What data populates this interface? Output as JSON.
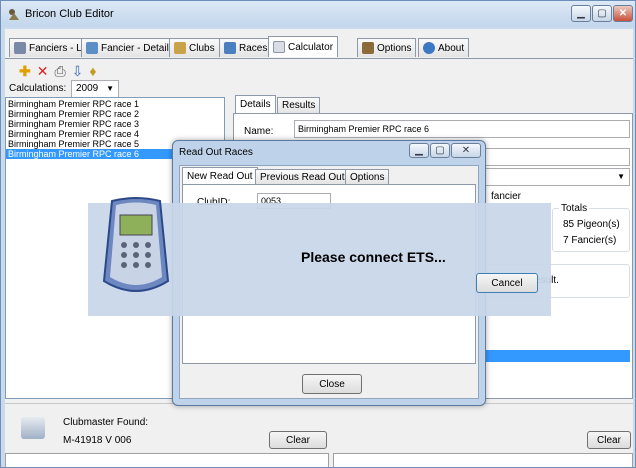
{
  "window": {
    "title": "Bricon Club Editor"
  },
  "tabs": [
    {
      "label": "Fanciers - List",
      "icon": "users-icon"
    },
    {
      "label": "Fancier - Detail",
      "icon": "user-icon"
    },
    {
      "label": "Clubs",
      "icon": "clubs-icon"
    },
    {
      "label": "Races",
      "icon": "flag-icon"
    },
    {
      "label": "Calculator",
      "icon": "calculator-icon"
    },
    {
      "label": "Options",
      "icon": "tools-icon"
    },
    {
      "label": "About",
      "icon": "info-icon"
    }
  ],
  "calc": {
    "label": "Calculations:",
    "year": "2009",
    "races": [
      "Birmingham Premier RPC race 1",
      "Birmingham Premier RPC race 2",
      "Birmingham Premier RPC race 3",
      "Birmingham Premier RPC race 4",
      "Birmingham Premier RPC race 5",
      "Birmingham Premier RPC race 6"
    ],
    "selected_index": 5
  },
  "details": {
    "tabs": [
      "Details",
      "Results"
    ],
    "name_label": "Name:",
    "name_value": "Birmingham Premier RPC race 6",
    "fancier_label": "fancier",
    "totals_label": "Totals",
    "pigeons": "85 Pigeon(s)",
    "fanciers": "7 Fancier(s)",
    "result_text": "esult."
  },
  "dialog": {
    "title": "Read Out Races",
    "tabs": [
      "New Read Out",
      "Previous Read Outs",
      "Options"
    ],
    "clubid_label": "ClubID:",
    "clubid_value": "0053",
    "close_label": "Close"
  },
  "overlay": {
    "message": "Please connect ETS...",
    "cancel_label": "Cancel"
  },
  "bottom": {
    "found_label": "Clubmaster Found:",
    "device": "M-41918 V 006",
    "clear_label": "Clear",
    "clear2_label": "Clear"
  },
  "colors": {
    "selection": "#3399ff",
    "window_frame": "#c9daec",
    "overlay": "#c8d6ea"
  }
}
